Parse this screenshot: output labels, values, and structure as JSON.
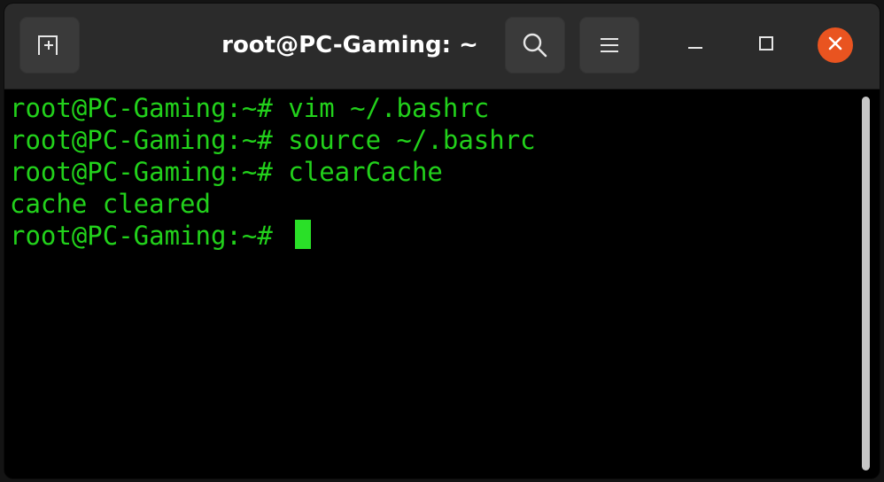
{
  "window": {
    "title": "root@PC-Gaming: ~"
  },
  "titlebar": {
    "icons": {
      "new_tab": "new-tab-icon",
      "search": "search-icon",
      "menu": "hamburger-menu-icon",
      "minimize": "minimize-icon",
      "maximize": "maximize-icon",
      "close": "close-icon"
    },
    "close_color": "#e95420"
  },
  "terminal": {
    "text_color": "#22d11b",
    "background": "#000000",
    "lines": [
      {
        "prompt": "root@PC-Gaming:~# ",
        "command": "vim ~/.bashrc"
      },
      {
        "prompt": "root@PC-Gaming:~# ",
        "command": "source ~/.bashrc"
      },
      {
        "prompt": "root@PC-Gaming:~# ",
        "command": "clearCache"
      },
      {
        "output": "cache cleared"
      },
      {
        "prompt": "root@PC-Gaming:~# ",
        "command": ""
      }
    ]
  }
}
